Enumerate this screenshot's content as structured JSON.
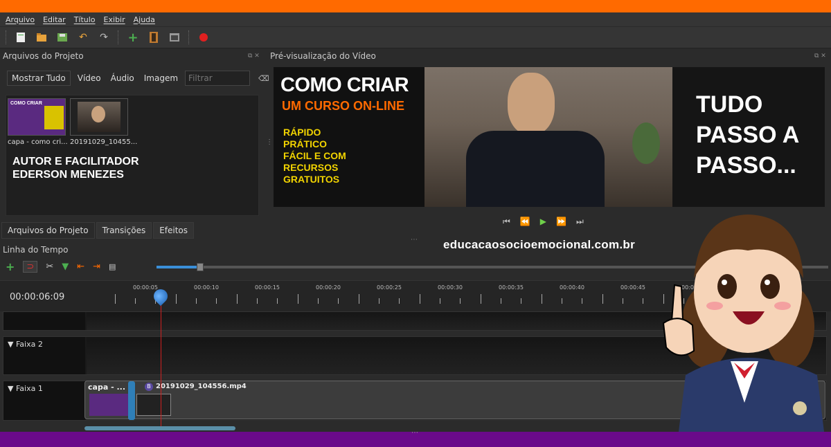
{
  "menu": [
    "Arquivo",
    "Editar",
    "Título",
    "Exibir",
    "Ajuda"
  ],
  "toolbar_icons": [
    "new-project-icon",
    "open-project-icon",
    "save-project-icon",
    "undo-icon",
    "redo-icon",
    "import-files-icon",
    "profile-icon",
    "fullscreen-icon",
    "record-icon"
  ],
  "project_panel": {
    "title": "Arquivos do Projeto",
    "filters": [
      "Mostrar Tudo",
      "Vídeo",
      "Áudio",
      "Imagem"
    ],
    "filter_placeholder": "Filtrar",
    "files": [
      {
        "label": "capa - como cri...",
        "thumb_title": "COMO CRIAR"
      },
      {
        "label": "20191029_10455..."
      }
    ],
    "overlay_line1": "AUTOR E FACILITADOR",
    "overlay_line2": "EDERSON MENEZES"
  },
  "bottom_tabs": [
    "Arquivos do Projeto",
    "Transições",
    "Efeitos"
  ],
  "preview": {
    "title": "Pré-visualização do Vídeo",
    "headline": "COMO CRIAR",
    "subheadline": "UM CURSO ON-LINE",
    "features": [
      "RÁPIDO",
      "PRÁTICO",
      "FÁCIL E COM",
      "RECURSOS",
      "GRATUITOS"
    ],
    "right_lines": [
      "TUDO",
      "PASSO A",
      "PASSO..."
    ]
  },
  "url": "educacaosocioemocional.com.br",
  "timeline": {
    "title": "Linha do Tempo",
    "current_time": "00:00:06:09",
    "ticks": [
      "00:00:05",
      "00:00:10",
      "00:00:15",
      "00:00:20",
      "00:00:25",
      "00:00:30",
      "00:00:35",
      "00:00:40",
      "00:00:45",
      "00:00:50"
    ],
    "tracks": [
      "Faixa 2",
      "Faixa 1"
    ],
    "clip_capa": "capa - ...",
    "clip_video": "20191029_104556.mp4",
    "clip_badge": "B"
  },
  "colors": {
    "orange": "#ff6a00",
    "purple": "#6a0a8a",
    "yellow": "#f2d400",
    "accent": "#3a8fd8"
  }
}
